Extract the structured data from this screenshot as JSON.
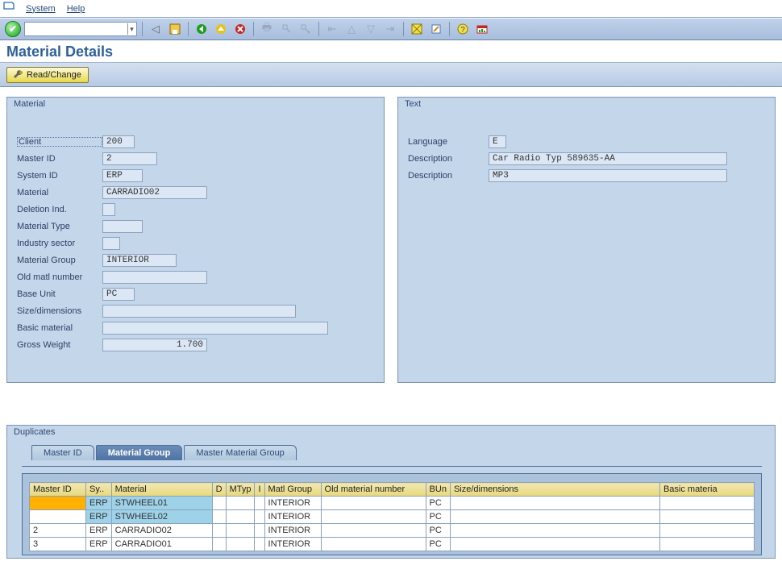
{
  "menu": {
    "system": "System",
    "help": "Help"
  },
  "title": "Material Details",
  "apptoolbar": {
    "read_change": "Read/Change"
  },
  "panels": {
    "material": {
      "title": "Material",
      "labels": {
        "client": "Client",
        "master_id": "Master ID",
        "system_id": "System ID",
        "material": "Material",
        "deletion_ind": "Deletion Ind.",
        "material_type": "Material Type",
        "industry_sector": "Industry sector",
        "material_group": "Material Group",
        "old_matl_number": "Old matl number",
        "base_unit": "Base Unit",
        "size_dimensions": "Size/dimensions",
        "basic_material": "Basic material",
        "gross_weight": "Gross Weight"
      },
      "values": {
        "client": "200",
        "master_id": "2",
        "system_id": "ERP",
        "material": "CARRADIO02",
        "deletion_ind": "",
        "material_type": "",
        "industry_sector": "",
        "material_group": "INTERIOR",
        "old_matl_number": "",
        "base_unit": "PC",
        "size_dimensions": "",
        "basic_material": "",
        "gross_weight": "1.700"
      }
    },
    "text": {
      "title": "Text",
      "labels": {
        "language": "Language",
        "description1": "Description",
        "description2": "Description"
      },
      "values": {
        "language": "E",
        "description1": "Car Radio Typ 589635-AA",
        "description2": "MP3"
      }
    }
  },
  "duplicates": {
    "title": "Duplicates",
    "tabs": {
      "master_id": "Master ID",
      "material_group": "Material Group",
      "master_material_group": "Master Material Group"
    },
    "columns": {
      "master_id": "Master ID",
      "sy": "Sy..",
      "material": "Material",
      "d": "D",
      "mtyp": "MTyp",
      "i": "I",
      "matl_group": "Matl Group",
      "old_mat": "Old material number",
      "bun": "BUn",
      "size": "Size/dimensions",
      "basic_mat": "Basic materia"
    },
    "rows": [
      {
        "master_id": "",
        "sy": "ERP",
        "material": "STWHEEL01",
        "d": "",
        "mtyp": "",
        "i": "",
        "matl_group": "INTERIOR",
        "old": "",
        "bun": "PC",
        "size": "",
        "bm": "",
        "sel": true,
        "hl": true
      },
      {
        "master_id": "",
        "sy": "ERP",
        "material": "STWHEEL02",
        "d": "",
        "mtyp": "",
        "i": "",
        "matl_group": "INTERIOR",
        "old": "",
        "bun": "PC",
        "size": "",
        "bm": "",
        "sel": false,
        "hl": true
      },
      {
        "master_id": "2",
        "sy": "ERP",
        "material": "CARRADIO02",
        "d": "",
        "mtyp": "",
        "i": "",
        "matl_group": "INTERIOR",
        "old": "",
        "bun": "PC",
        "size": "",
        "bm": "",
        "sel": false,
        "hl": false
      },
      {
        "master_id": "3",
        "sy": "ERP",
        "material": "CARRADIO01",
        "d": "",
        "mtyp": "",
        "i": "",
        "matl_group": "INTERIOR",
        "old": "",
        "bun": "PC",
        "size": "",
        "bm": "",
        "sel": false,
        "hl": false
      }
    ]
  },
  "icons": {
    "back": "◀",
    "save": "💾",
    "nav_back": "⬅",
    "nav_exit": "⬆",
    "nav_cancel": "✖",
    "print": "🖨",
    "find": "🔍",
    "find_next": "🔎",
    "first": "⇤",
    "prev": "◁",
    "next": "▷",
    "last": "⇥",
    "new_session": "▦",
    "shortcut": "▤",
    "help": "❓",
    "layout": "📊",
    "wrench": "🔧"
  },
  "colors": {
    "green": "#1a9e1a",
    "yellow": "#e0c030",
    "red": "#cc2222"
  }
}
